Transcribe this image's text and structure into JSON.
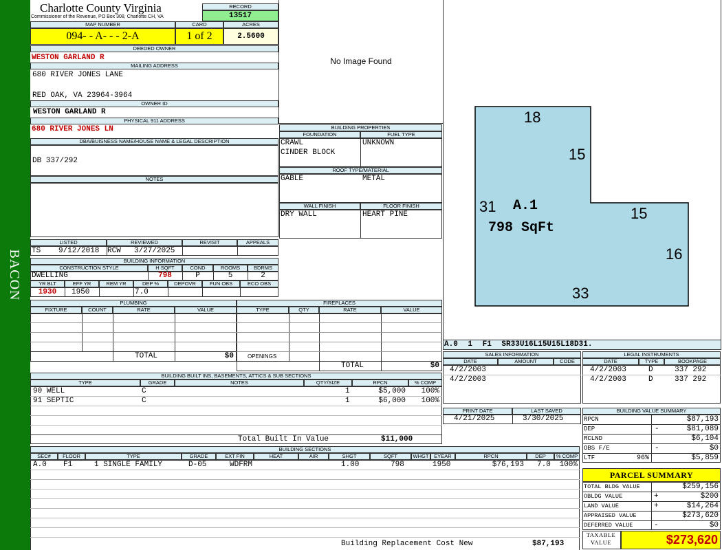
{
  "side_label": "BACON",
  "county_title": "Charlotte County Virginia",
  "commissioner_line": "Commissioner of the Revenue, PO Box 308, Charlotte CH, VA",
  "labels": {
    "record": "RECORD",
    "map_number": "MAP NUMBER",
    "card": "CARD",
    "acres": "ACRES",
    "deeded_owner": "DEEDED OWNER",
    "mailing_address": "MAILING ADDRESS",
    "owner_id": "OWNER ID",
    "physical_address": "PHYSICAL 911 ADDRESS",
    "dba": "DBA/BUISNESS NAME/HOUSE NAME & LEGAL DESCRIPTION",
    "notes": "NOTES",
    "listed": "LISTED",
    "reviewed": "REVIEWED",
    "revisit": "REVISIT",
    "appeals": "APPEALS",
    "building_information": "BUILDING INFORMATION",
    "construction_style": "CONSTRUCTION STYLE",
    "hsqft": "H SQFT",
    "cond": "COND",
    "rooms": "ROOMS",
    "bdrms": "BDRMS",
    "yr_blt": "YR BLT",
    "eff_yr": "EFF YR",
    "rem_yr": "REM YR",
    "dep_pct": "DEP %",
    "depovr": "DEPOVR",
    "fun_obs": "FUN OBS",
    "eco_obs": "ECO OBS",
    "building_properties": "BUILDING PROPERTIES",
    "foundation": "FOUNDATION",
    "fuel_type": "FUEL TYPE",
    "roof_type": "ROOF TYPE/MATERIAL",
    "wall_finish": "WALL FINISH",
    "floor_finish": "FLOOR FINISH",
    "plumbing": "PLUMBING",
    "fixture": "FIXTURE",
    "count": "COUNT",
    "rate": "RATE",
    "value": "VALUE",
    "total": "TOTAL",
    "fireplaces": "FIREPLACES",
    "type": "TYPE",
    "qty": "QTY",
    "openings": "OPENINGS",
    "sales_information": "SALES INFORMATION",
    "date": "DATE",
    "amount": "AMOUNT",
    "code": "CODE",
    "legal_instruments": "LEGAL INSTRUMENTS",
    "bookpage": "BOOKPAGE",
    "built_ins": "BUILDING BUILT INS, BASEMENTS, ATTICS & SUB SECTIONS",
    "grade": "GRADE",
    "notes_col": "NOTES",
    "qty_size": "QTY/SIZE",
    "rpcn": "RPCN",
    "pct_comp": "% COMP",
    "total_built_in": "Total Built In Value",
    "print_date": "PRINT DATE",
    "last_saved": "LAST SAVED",
    "building_value_summary": "BUILDING VALUE SUMMARY",
    "parcel_summary": "PARCEL SUMMARY",
    "building_sections": "BUILDING SECTIONS",
    "sec": "SEC#",
    "floor": "FLOOR",
    "ext_fin": "EXT FIN",
    "heat": "HEAT",
    "air": "AIR",
    "shgt": "SHGT",
    "sqft": "SQFT",
    "whgt": "WHGT",
    "eyear": "EYEAR",
    "dep": "DEP",
    "brcn": "Building Replacement Cost New"
  },
  "record": "13517",
  "map_number": "094- - A- - - 2-A",
  "card": "1 of 2",
  "acres": "2.5600",
  "deeded_owner": "WESTON GARLAND R",
  "mailing_line1": "680 RIVER JONES LANE",
  "mailing_line2": "RED OAK, VA 23964-3964",
  "owner_id": "WESTON GARLAND R",
  "physical_address": "680 RIVER JONES LN",
  "legal_description": "DB 337/292",
  "photo_placeholder": "No Image Found",
  "listed": {
    "by": "TS",
    "date": "9/12/2018"
  },
  "reviewed": {
    "by": "RCW",
    "date": "3/27/2025"
  },
  "construction_style": "DWELLING",
  "hsqft": "798",
  "cond": "P",
  "rooms": "5",
  "bdrms": "2",
  "yr_blt": "1930",
  "eff_yr": "1950",
  "dep_pct": "7.0",
  "foundation": [
    "CRAWL",
    "CINDER BLOCK"
  ],
  "fuel_type": "UNKNOWN",
  "roof": [
    "GABLE",
    "METAL"
  ],
  "wall_finish": "DRY WALL",
  "floor_finish": "HEART PINE",
  "sketch": {
    "labels": [
      "18",
      "15",
      "31",
      "15",
      "16",
      "33"
    ],
    "section": "A.1",
    "area": "798 SqFt",
    "fill": "#add8e6"
  },
  "sketch_code": "A.0 1 F1 SR33U16L15U15L18D31.",
  "plumbing_total": "$0",
  "fireplace_total": "$0",
  "sales": [
    {
      "date": "4/2/2003",
      "amount": "",
      "code": ""
    },
    {
      "date": "4/2/2003",
      "amount": "",
      "code": ""
    }
  ],
  "legal": [
    {
      "date": "4/2/2003",
      "type": "D",
      "bookpage": "337 292"
    },
    {
      "date": "4/2/2003",
      "type": "D",
      "bookpage": "337 292"
    }
  ],
  "built_ins": [
    {
      "type": "90 WELL",
      "grade": "C",
      "qty": "1",
      "rpcn": "$5,000",
      "comp": "100%"
    },
    {
      "type": "91 SEPTIC",
      "grade": "C",
      "qty": "1",
      "rpcn": "$6,000",
      "comp": "100%"
    }
  ],
  "total_built_in": "$11,000",
  "print_date": "4/21/2025",
  "last_saved": "3/30/2025",
  "value_summary": [
    {
      "label": "RPCN",
      "sign": "",
      "value": "$87,193"
    },
    {
      "label": "DEP",
      "sign": "-",
      "value": "$81,089"
    },
    {
      "label": "RCLND",
      "sign": "",
      "value": "$6,104"
    },
    {
      "label": "OBS F/E",
      "sign": "-",
      "value": "$0"
    },
    {
      "label": "LTF",
      "sign": "96%",
      "value": "$5,859"
    }
  ],
  "parcel": [
    {
      "label": "TOTAL BLDG VALUE",
      "sign": "",
      "value": "$259,156"
    },
    {
      "label": "OBLDG VALUE",
      "sign": "+",
      "value": "$200"
    },
    {
      "label": "LAND VALUE",
      "sign": "+",
      "value": "$14,264"
    },
    {
      "label": "APPRAISED VALUE",
      "sign": "",
      "value": "$273,620"
    },
    {
      "label": "DEFERRED VALUE",
      "sign": "-",
      "value": "$0"
    }
  ],
  "taxable_label": "TAXABLE VALUE",
  "taxable_value": "$273,620",
  "sections": [
    {
      "sec": "A.0",
      "floor": "F1",
      "type": "1 SINGLE FAMILY",
      "grade": "D-05",
      "ext": "WDFRM",
      "heat": "",
      "air": "",
      "shgt": "1.00",
      "sqft": "798",
      "whgt": "",
      "eyear": "1950",
      "rpcn": "$76,193",
      "dep": "7.0",
      "comp": "100%"
    }
  ],
  "brcn": "$87,193",
  "colors": {
    "sidebar": "#0b7a0b",
    "header": "#dbeef4",
    "record": "#90ee90",
    "map": "#ffff00",
    "acres": "#ffffe0",
    "red": "#c00000"
  }
}
